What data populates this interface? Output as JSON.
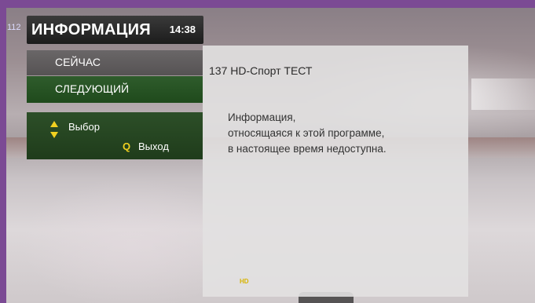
{
  "osd": {
    "channel_number": "112",
    "title": "ИНФОРМАЦИЯ",
    "clock": "14:38",
    "menu": {
      "now_label": "СЕЙЧАС",
      "next_label": "СЛЕДУЮЩИЙ"
    },
    "help": {
      "select_label": "Выбор",
      "exit_key": "Q",
      "exit_label": "Выход"
    }
  },
  "detail": {
    "channel": "137 HD-Спорт ТЕСТ",
    "message_lines": [
      "Информация,",
      "относящаяся к этой программе,",
      "в настоящее время недоступна."
    ],
    "badge": "HD"
  },
  "colors": {
    "frame": "#7b4a94",
    "menu_selected": "#2f5c2c",
    "q_key": "#f0d020",
    "badge": "#d8b400"
  }
}
